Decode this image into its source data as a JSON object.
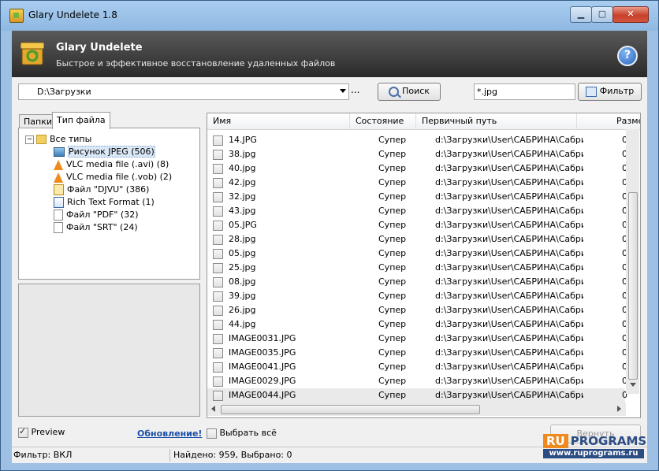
{
  "window": {
    "title": "Glary Undelete 1.8",
    "buttons": {
      "minimize": "▁",
      "maximize": "▢",
      "close": "✕"
    }
  },
  "banner": {
    "title": "Glary Undelete",
    "subtitle": "Быстрое и эффективное восстановление удаленных файлов",
    "help": "?"
  },
  "toolbar": {
    "path_value": "D:\\Загрузки",
    "browse_label": "...",
    "search_label": "Поиск",
    "mask_value": "*.jpg",
    "filter_label": "Фильтр"
  },
  "left_tabs": {
    "folders": "Папки",
    "filetype": "Тип файла"
  },
  "tree": {
    "expander": "−",
    "root": "Все типы",
    "items": [
      {
        "label": "Рисунок JPEG (506)",
        "icon": "jpeg-image-icon",
        "selected": true
      },
      {
        "label": "VLC media file (.avi) (8)",
        "icon": "vlc-cone-icon"
      },
      {
        "label": "VLC media file (.vob) (2)",
        "icon": "vlc-cone-icon"
      },
      {
        "label": "Файл \"DJVU\" (386)",
        "icon": "djvu-file-icon"
      },
      {
        "label": "Rich Text Format (1)",
        "icon": "rtf-document-icon"
      },
      {
        "label": "Файл \"PDF\" (32)",
        "icon": "blank-file-icon"
      },
      {
        "label": "Файл \"SRT\" (24)",
        "icon": "blank-file-icon"
      }
    ]
  },
  "preview": {
    "label": "Preview",
    "checked": true
  },
  "update_link": "Обновление!",
  "select_all": {
    "label": "Выбрать всё",
    "checked": false
  },
  "restore_label": "Вернуть",
  "table": {
    "columns": [
      "Имя",
      "Состояние",
      "Первичный путь",
      "Разме"
    ],
    "rows": [
      {
        "name": "14.JPG",
        "state": "Супер",
        "path": "d:\\Загрузки\\User\\САБРИНА\\Сабрина\\",
        "size": "0"
      },
      {
        "name": "38.jpg",
        "state": "Супер",
        "path": "d:\\Загрузки\\User\\САБРИНА\\Сабрина\\",
        "size": "0"
      },
      {
        "name": "40.jpg",
        "state": "Супер",
        "path": "d:\\Загрузки\\User\\САБРИНА\\Сабрина\\",
        "size": "0"
      },
      {
        "name": "42.jpg",
        "state": "Супер",
        "path": "d:\\Загрузки\\User\\САБРИНА\\Сабрина\\",
        "size": "0"
      },
      {
        "name": "32.jpg",
        "state": "Супер",
        "path": "d:\\Загрузки\\User\\САБРИНА\\Сабрина\\",
        "size": "0"
      },
      {
        "name": "43.jpg",
        "state": "Супер",
        "path": "d:\\Загрузки\\User\\САБРИНА\\Сабрина\\",
        "size": "0"
      },
      {
        "name": "05.JPG",
        "state": "Супер",
        "path": "d:\\Загрузки\\User\\САБРИНА\\Сабрина\\",
        "size": "0"
      },
      {
        "name": "28.jpg",
        "state": "Супер",
        "path": "d:\\Загрузки\\User\\САБРИНА\\Сабрина\\",
        "size": "0"
      },
      {
        "name": "05.jpg",
        "state": "Супер",
        "path": "d:\\Загрузки\\User\\САБРИНА\\Сабрина\\",
        "size": "0"
      },
      {
        "name": "25.jpg",
        "state": "Супер",
        "path": "d:\\Загрузки\\User\\САБРИНА\\Сабрина\\",
        "size": "0"
      },
      {
        "name": "08.jpg",
        "state": "Супер",
        "path": "d:\\Загрузки\\User\\САБРИНА\\Сабрина\\",
        "size": "0"
      },
      {
        "name": "39.jpg",
        "state": "Супер",
        "path": "d:\\Загрузки\\User\\САБРИНА\\Сабрина\\",
        "size": "0"
      },
      {
        "name": "26.jpg",
        "state": "Супер",
        "path": "d:\\Загрузки\\User\\САБРИНА\\Сабрина\\",
        "size": "0"
      },
      {
        "name": "44.jpg",
        "state": "Супер",
        "path": "d:\\Загрузки\\User\\САБРИНА\\Сабрина\\",
        "size": "0"
      },
      {
        "name": "IMAGE0031.JPG",
        "state": "Супер",
        "path": "d:\\Загрузки\\User\\САБРИНА\\Сабрина\\",
        "size": "0"
      },
      {
        "name": "IMAGE0035.JPG",
        "state": "Супер",
        "path": "d:\\Загрузки\\User\\САБРИНА\\Сабрина\\",
        "size": "0"
      },
      {
        "name": "IMAGE0041.JPG",
        "state": "Супер",
        "path": "d:\\Загрузки\\User\\САБРИНА\\Сабрина\\",
        "size": "0"
      },
      {
        "name": "IMAGE0029.JPG",
        "state": "Супер",
        "path": "d:\\Загрузки\\User\\САБРИНА\\Сабрина\\",
        "size": "0"
      },
      {
        "name": "IMAGE0044.JPG",
        "state": "Супер",
        "path": "d:\\Загрузки\\User\\САБРИНА\\Сабрина\\",
        "size": "0",
        "highlighted": true
      }
    ]
  },
  "status": {
    "filter": "Фильтр: ВКЛ",
    "found": "Найдено: 959, Выбрано: 0"
  },
  "watermark": {
    "ru": "RU",
    "programs": "PROGRAMS",
    "url": "www.ruprograms.ru"
  }
}
